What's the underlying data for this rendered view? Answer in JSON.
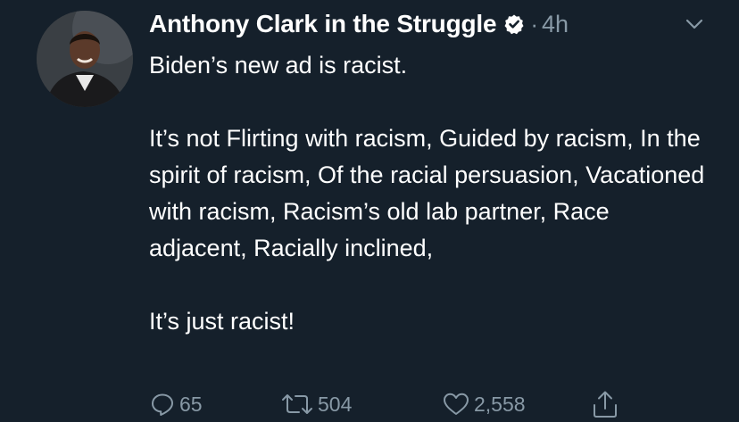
{
  "author": {
    "display_name": "Anthony Clark in the Struggle",
    "verified": true,
    "separator": "·",
    "timestamp": "4h"
  },
  "tweet": {
    "lines": [
      "Biden’s new ad is racist.",
      "It’s not Flirting with racism, Guided by racism, In the spirit of racism, Of the racial persuasion, Vacationed with racism, Racism’s old lab partner, Race adjacent, Racially inclined,",
      "It’s just racist!"
    ]
  },
  "actions": {
    "reply_count": "65",
    "retweet_count": "504",
    "like_count": "2,558"
  },
  "icons": {
    "verified": "verified-badge-icon",
    "menu": "chevron-down-icon",
    "reply": "reply-icon",
    "retweet": "retweet-icon",
    "like": "heart-icon",
    "share": "share-icon"
  },
  "colors": {
    "background": "#15202b",
    "text": "#ffffff",
    "muted": "#8899a6"
  }
}
